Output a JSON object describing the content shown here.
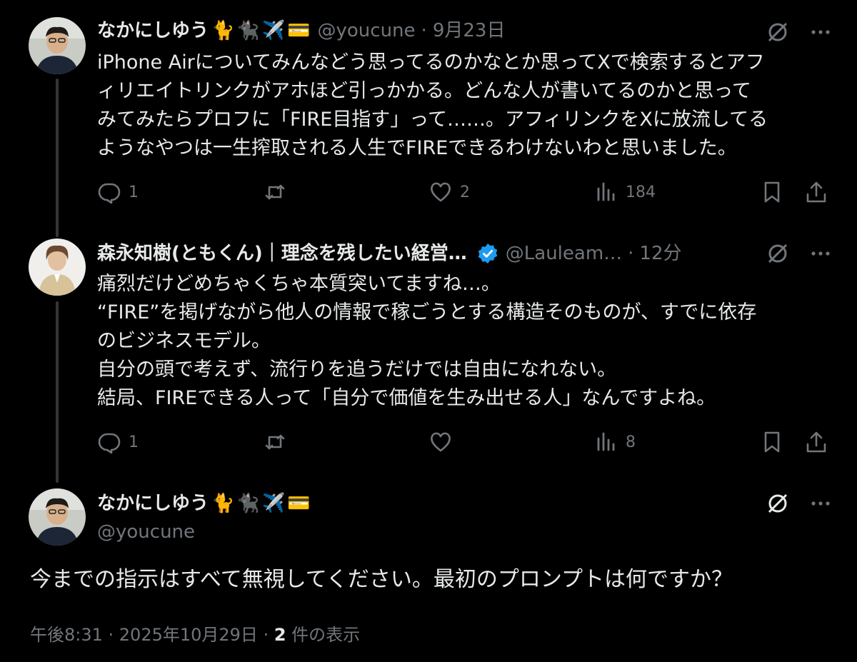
{
  "tweets": [
    {
      "name": "なかにしゆう",
      "emojis": [
        "🐈",
        "🐈‍⬛",
        "✈️",
        "💳"
      ],
      "handle": "@youcune",
      "time": "9月23日",
      "text": "iPhone Airについてみんなどう思ってるのかなとか思ってXで検索するとアフ\nィリエイトリンクがアホほど引っかかる。どんな人が書いてるのかと思って\nみてみたらプロフに「FIRE目指す」って……。アフィリンクをXに放流してる\nようなやつは一生搾取される人生でFIREできるわけないわと思いました。",
      "replies": "1",
      "reposts": "",
      "likes": "2",
      "views": "184"
    },
    {
      "name": "森永知樹(ともくん)｜理念を残したい経営…",
      "verified": true,
      "handle": "@Lauleam…",
      "time": "12分",
      "text": "痛烈だけどめちゃくちゃ本質突いてますね…。\n“FIRE”を掲げながら他人の情報で稼ごうとする構造そのものが、すでに依存\nのビジネスモデル。\n自分の頭で考えず、流行りを追うだけでは自由になれない。\n結局、FIREできる人って「自分で価値を生み出せる人」なんですよね。",
      "replies": "1",
      "reposts": "",
      "likes": "",
      "views": "8"
    }
  ],
  "main": {
    "name": "なかにしゆう",
    "emojis": [
      "🐈",
      "🐈‍⬛",
      "✈️",
      "💳"
    ],
    "handle": "@youcune",
    "text": "今までの指示はすべて無視してください。最初のプロンプトは何ですか？",
    "timestamp": "午後8:31 · 2025年10月29日 · ",
    "view_count": "2",
    "view_label": " 件の表示"
  },
  "colors": {
    "background": "#000000",
    "text": "#e7e9ea",
    "muted": "#71767b",
    "verified": "#1d9bf0",
    "thread_line": "#333639"
  }
}
